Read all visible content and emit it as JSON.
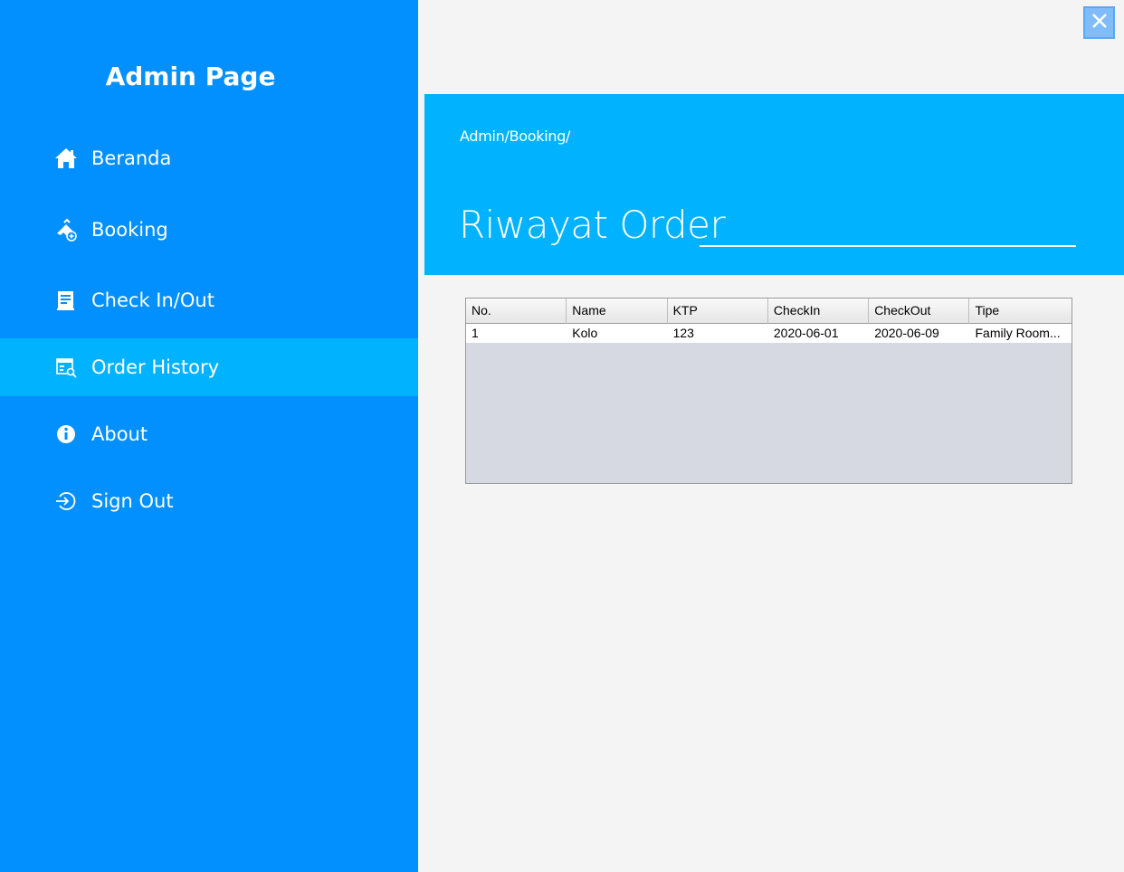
{
  "sidebar": {
    "title": "Admin Page",
    "items": [
      {
        "label": "Beranda",
        "icon": "home-icon"
      },
      {
        "label": "Booking",
        "icon": "booking-icon"
      },
      {
        "label": "Check In/Out",
        "icon": "checkin-icon"
      },
      {
        "label": "Order History",
        "icon": "order-history-icon",
        "active": true
      },
      {
        "label": "About",
        "icon": "info-icon"
      },
      {
        "label": "Sign Out",
        "icon": "sign-out-icon"
      }
    ]
  },
  "window": {
    "close_icon": "close-icon"
  },
  "header": {
    "breadcrumb": "Admin/Booking/",
    "title": "Riwayat Order"
  },
  "table": {
    "columns": [
      "No.",
      "Name",
      "KTP",
      "CheckIn",
      "CheckOut",
      "Tipe"
    ],
    "rows": [
      [
        "1",
        "Kolo",
        "123",
        "2020-06-01",
        "2020-06-09",
        "Family Room..."
      ]
    ]
  },
  "colors": {
    "sidebar_bg": "#0290fe",
    "accent": "#01b3fe",
    "content_bg": "#f4f4f4",
    "table_empty_bg": "#d6d9e1"
  }
}
